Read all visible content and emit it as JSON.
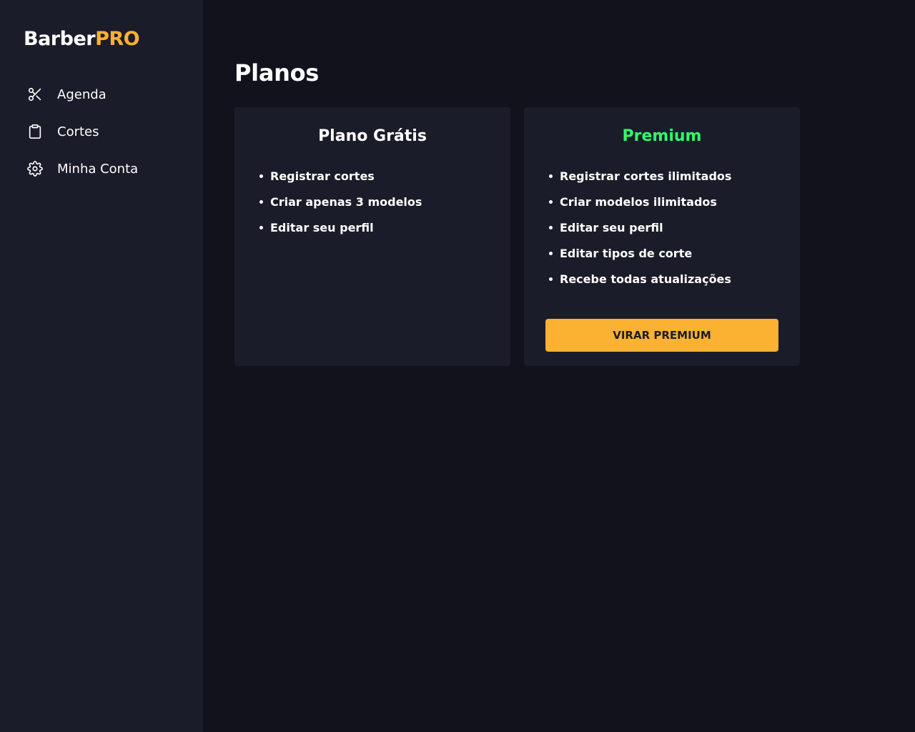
{
  "brand": {
    "name": "Barber",
    "accent": "PRO",
    "accent_color": "#fbb131"
  },
  "sidebar": {
    "items": [
      {
        "label": "Agenda",
        "icon": "scissors-icon"
      },
      {
        "label": "Cortes",
        "icon": "clipboard-icon"
      },
      {
        "label": "Minha Conta",
        "icon": "gear-icon"
      }
    ]
  },
  "page": {
    "title": "Planos"
  },
  "plans": {
    "free": {
      "title": "Plano Grátis",
      "features": [
        "Registrar cortes",
        "Criar apenas 3 modelos",
        "Editar seu perfil"
      ]
    },
    "premium": {
      "title": "Premium",
      "title_color": "#31fb6a",
      "features": [
        "Registrar cortes ilimitados",
        "Criar modelos ilimitados",
        "Editar seu perfil",
        "Editar tipos de corte",
        "Recebe todas atualizações"
      ],
      "button_label": "VIRAR PREMIUM",
      "button_color": "#fbb131"
    }
  },
  "colors": {
    "background": "#12121c",
    "sidebar": "#1b1c29",
    "card": "#1b1c29"
  }
}
